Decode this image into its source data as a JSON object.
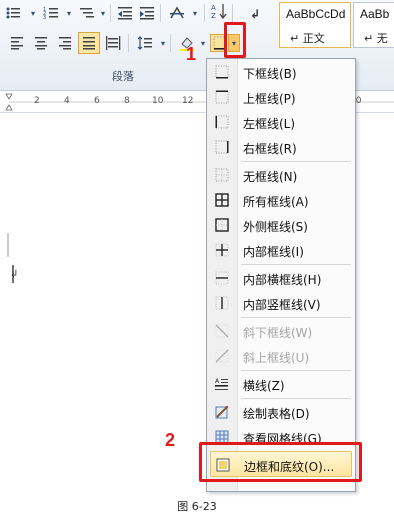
{
  "ribbon": {
    "group_label": "段落",
    "styles": [
      {
        "preview": "AaBbCcDd",
        "name": "↵ 正文"
      },
      {
        "preview": "AaBb",
        "name": "↵ 无"
      }
    ]
  },
  "ruler": {
    "numbers": [
      "2",
      "4",
      "6",
      "8",
      "10",
      "12",
      "14",
      "16",
      "18",
      "20"
    ]
  },
  "callouts": {
    "step1": "1",
    "step2": "2"
  },
  "border_menu": {
    "items": [
      {
        "label": "下框线(B)",
        "icon": "bottom-border-icon",
        "disabled": false
      },
      {
        "label": "上框线(P)",
        "icon": "top-border-icon",
        "disabled": false
      },
      {
        "label": "左框线(L)",
        "icon": "left-border-icon",
        "disabled": false
      },
      {
        "label": "右框线(R)",
        "icon": "right-border-icon",
        "disabled": false
      },
      {
        "label": "无框线(N)",
        "icon": "no-border-icon",
        "disabled": false
      },
      {
        "label": "所有框线(A)",
        "icon": "all-borders-icon",
        "disabled": false
      },
      {
        "label": "外侧框线(S)",
        "icon": "outside-borders-icon",
        "disabled": false
      },
      {
        "label": "内部框线(I)",
        "icon": "inside-borders-icon",
        "disabled": false
      },
      {
        "label": "内部横框线(H)",
        "icon": "inside-horizontal-border-icon",
        "disabled": false
      },
      {
        "label": "内部竖框线(V)",
        "icon": "inside-vertical-border-icon",
        "disabled": false
      },
      {
        "label": "斜下框线(W)",
        "icon": "diagonal-down-border-icon",
        "disabled": true
      },
      {
        "label": "斜上框线(U)",
        "icon": "diagonal-up-border-icon",
        "disabled": true
      },
      {
        "label": "横线(Z)",
        "icon": "horizontal-line-icon",
        "disabled": false
      },
      {
        "label": "绘制表格(D)",
        "icon": "draw-table-icon",
        "disabled": false
      },
      {
        "label": "查看网格线(G)",
        "icon": "view-gridlines-icon",
        "disabled": false
      },
      {
        "label": "边框和底纹(O)...",
        "icon": "borders-shading-icon",
        "disabled": false,
        "highlighted": true
      }
    ]
  },
  "caption": "图 6-23"
}
